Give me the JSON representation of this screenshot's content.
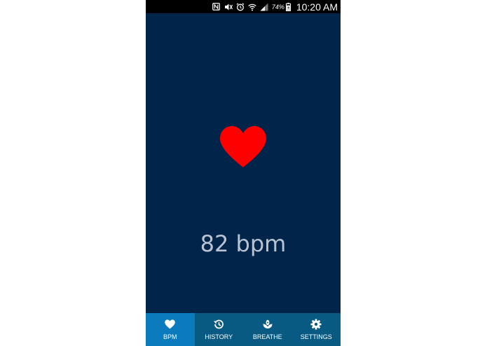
{
  "status_bar": {
    "icons": [
      "nfc-icon",
      "mute-icon",
      "alarm-icon",
      "wifi-icon",
      "signal-icon",
      "battery-icon"
    ],
    "battery_percent": "74%",
    "time": "10:20 AM"
  },
  "main": {
    "heart_icon": "heart-icon",
    "heart_color": "#ff0000",
    "bpm_text": "82 bpm"
  },
  "colors": {
    "background": "#01244a",
    "tabbar": "#095a83",
    "tab_active": "#0b7bbd"
  },
  "tabs": [
    {
      "label": "BPM",
      "icon": "heart-icon",
      "active": true
    },
    {
      "label": "HISTORY",
      "icon": "history-icon",
      "active": false
    },
    {
      "label": "BREATHE",
      "icon": "lotus-icon",
      "active": false
    },
    {
      "label": "SETTINGS",
      "icon": "gear-icon",
      "active": false
    }
  ]
}
